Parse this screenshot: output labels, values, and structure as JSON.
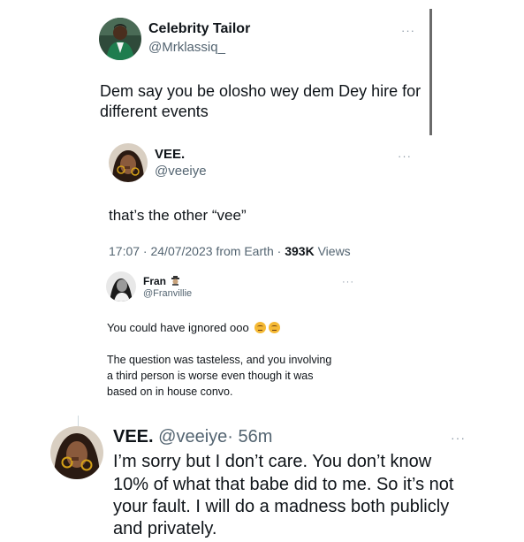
{
  "tweet1": {
    "display_name": "Celebrity Tailor",
    "handle": "@Mrklassiq_",
    "text_line1": "Dem say you be olosho wey dem Dey hire for",
    "text_line2": "different events",
    "more_label": "···"
  },
  "tweet2": {
    "display_name": "VEE.",
    "handle": "@veeiye",
    "text": "that’s the other “vee”",
    "meta_time": "17:07 · 24/07/2023 from Earth · ",
    "meta_views_count": "393K",
    "meta_views_label": " Views",
    "more_label": "···"
  },
  "tweet3": {
    "display_name": "Fran",
    "handle": "@Franvillie",
    "line1": "You could have ignored ooo",
    "para2_line1": "The question was tasteless, and you involving",
    "para2_line2": "a third person is worse even though it was",
    "para2_line3": "based on in house convo.",
    "more_label": "···"
  },
  "tweet4": {
    "display_name": "VEE.",
    "handle": "@veeiye",
    "time": "· 56m",
    "line1": "I’m sorry but I don’t care. You don’t know",
    "line2": "10% of what that babe did to me. So it’s not",
    "line3": "your fault. I will do a madness both publicly",
    "line4": "and privately.",
    "more_label": "···"
  },
  "emojis": [
    "unamused-face-icon",
    "unamused-face-icon"
  ]
}
